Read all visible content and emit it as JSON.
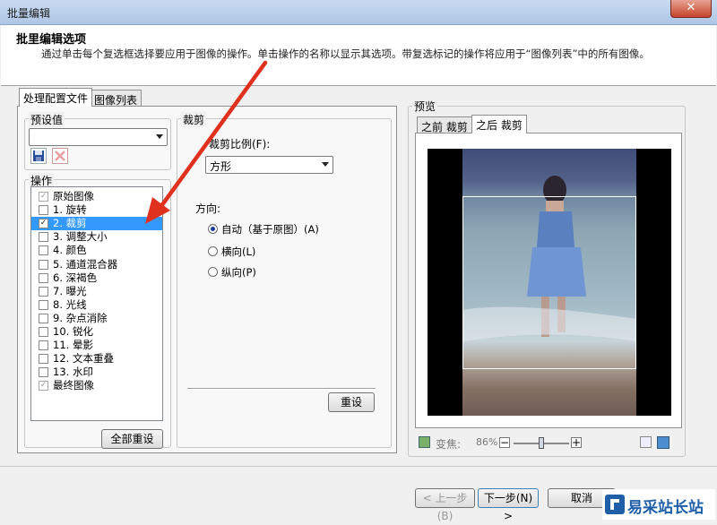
{
  "window": {
    "title": "批量编辑",
    "close_glyph": "✕"
  },
  "header": {
    "title": "批里编辑选项",
    "description": "通过单击每个复选框选择要应用于图像的操作。单击操作的名称以显示其选项。带复选标记的操作将应用于“图像列表”中的所有图像。"
  },
  "tabs": [
    {
      "label": "处理配置文件",
      "active": true
    },
    {
      "label": "图像列表",
      "active": false
    }
  ],
  "presets": {
    "label": "预设值",
    "value": ""
  },
  "operations": {
    "label": "操作",
    "items": [
      {
        "label": "原始图像",
        "checked": true,
        "disabled": true
      },
      {
        "label": "1.  旋转",
        "checked": false
      },
      {
        "label": "2.  裁剪",
        "checked": true,
        "selected": true
      },
      {
        "label": "3.  调整大小",
        "checked": false
      },
      {
        "label": "4.  颜色",
        "checked": false
      },
      {
        "label": "5.  通道混合器",
        "checked": false
      },
      {
        "label": "6.  深褐色",
        "checked": false
      },
      {
        "label": "7.  曝光",
        "checked": false
      },
      {
        "label": "8.  光线",
        "checked": false
      },
      {
        "label": "9.  杂点消除",
        "checked": false
      },
      {
        "label": "10.  锐化",
        "checked": false
      },
      {
        "label": "11.  晕影",
        "checked": false
      },
      {
        "label": "12.  文本重叠",
        "checked": false
      },
      {
        "label": "13.  水印",
        "checked": false
      },
      {
        "label": "最终图像",
        "checked": true,
        "disabled": true
      }
    ],
    "reset_all": "全部重设"
  },
  "crop": {
    "section_title": "裁剪",
    "ratio_label": "裁剪比例(F):",
    "ratio_value": "方形",
    "direction_label": "方向:",
    "directions": [
      {
        "label": "自动（基于原图）(A)",
        "selected": true
      },
      {
        "label": "横向(L)",
        "selected": false
      },
      {
        "label": "纵向(P)",
        "selected": false
      }
    ],
    "reset": "重设"
  },
  "preview": {
    "label": "预览",
    "tabs": [
      {
        "label": "之前 裁剪",
        "active": false
      },
      {
        "label": "之后 裁剪",
        "active": true
      }
    ],
    "zoom_label": "变焦:",
    "zoom_value": "86%",
    "zoom_level": 0.5
  },
  "footer": {
    "back": "< 上一步(B)",
    "next": "下一步(N) >",
    "cancel": "取消",
    "watermark": "易采站长站"
  },
  "colors": {
    "selection": "#3399ff",
    "arrow": "#e0301e"
  }
}
